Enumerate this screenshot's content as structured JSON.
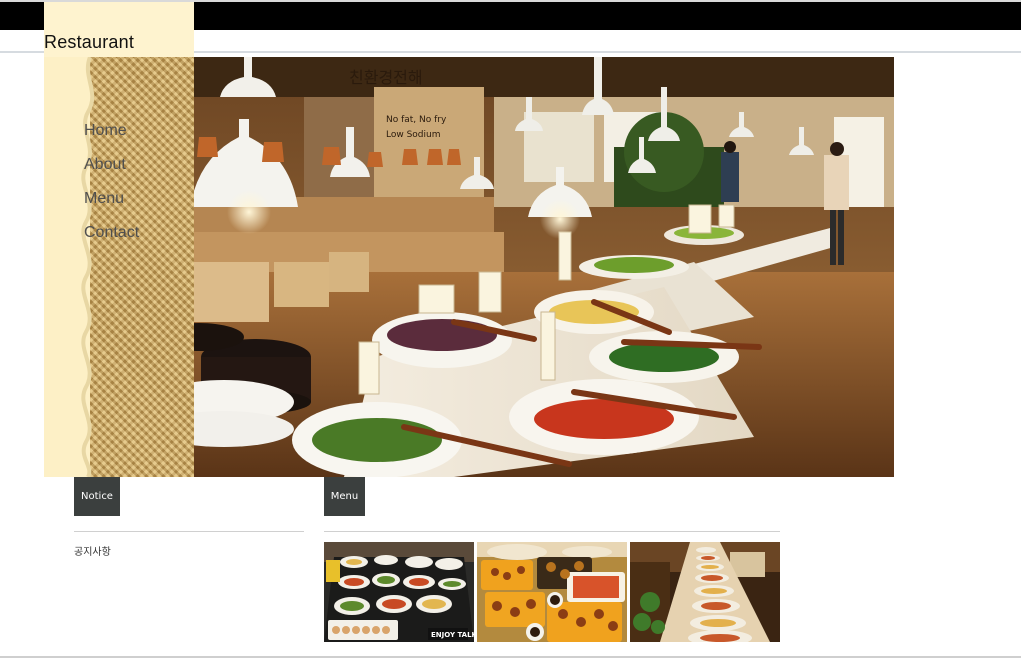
{
  "header": {
    "site_title": "Restaurant"
  },
  "nav": {
    "items": [
      {
        "label": "Home"
      },
      {
        "label": "About"
      },
      {
        "label": "Menu"
      },
      {
        "label": "Contact"
      }
    ]
  },
  "sections": {
    "notice": {
      "tab_label": "Notice",
      "text": "공지사항"
    },
    "menu": {
      "tab_label": "Menu",
      "thumbnails": [
        {
          "icon": "buffet-table-photo",
          "caption": "ENJOY TALK"
        },
        {
          "icon": "food-trays-photo"
        },
        {
          "icon": "buffet-line-photo"
        }
      ]
    }
  },
  "hero": {
    "icon": "salad-bar-photo",
    "sign_lines": [
      "친환경전해",
      "No fat, No fry",
      "Low Sodium"
    ]
  },
  "colors": {
    "top_bar": "#000000",
    "sidebar": "#fdf0c6",
    "tab_background": "#3b3f3e",
    "tab_text": "#ffffff",
    "nav_text": "#4f4f4f"
  }
}
